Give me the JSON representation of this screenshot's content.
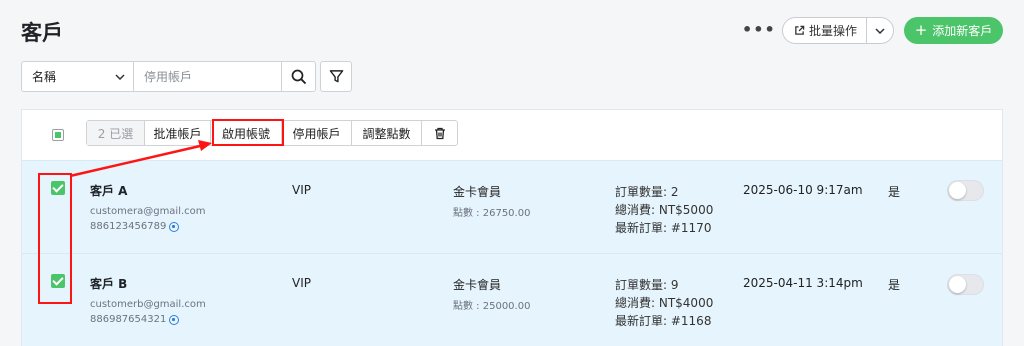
{
  "header": {
    "title": "客戶",
    "more_label": "•••",
    "bulk_label": "批量操作",
    "add_label": "添加新客戶",
    "add_symbol": "+"
  },
  "search": {
    "field_label": "名稱",
    "placeholder": "停用帳戶"
  },
  "bulk_actions": {
    "selected_count": "2 已選",
    "approve": "批准帳戶",
    "enable": "啟用帳號",
    "disable": "停用帳戶",
    "adjust_points": "調整點數"
  },
  "rows": [
    {
      "name": "客戶 A",
      "email": "customera@gmail.com",
      "phone": "886123456789",
      "tier": "VIP",
      "membership": "金卡會員",
      "points": "點數 : 26750.00",
      "order_count": "訂單數量: 2",
      "total_spent": "總消費: NT$5000",
      "latest_order": "最新訂單: #1170",
      "date": "2025-06-10 9:17am",
      "flag": "是",
      "checked": true,
      "enabled": false
    },
    {
      "name": "客戶 B",
      "email": "customerb@gmail.com",
      "phone": "886987654321",
      "tier": "VIP",
      "membership": "金卡會員",
      "points": "點數 : 25000.00",
      "order_count": "訂單數量: 9",
      "total_spent": "總消費: NT$4000",
      "latest_order": "最新訂單: #1168",
      "date": "2025-04-11 3:14pm",
      "flag": "是",
      "checked": true,
      "enabled": false
    }
  ],
  "colors": {
    "accent_green": "#4cc46a",
    "selected_row_bg": "#e6f5fd",
    "annotation_red": "#ff1414",
    "link_blue": "#2f7fd8"
  },
  "icons": {
    "more": "more-horizontal-icon",
    "bulk": "external-link-icon",
    "caret": "chevron-down-icon",
    "search": "search-icon",
    "filter": "filter-icon",
    "delete": "trash-icon",
    "phone": "whatsapp-icon"
  }
}
